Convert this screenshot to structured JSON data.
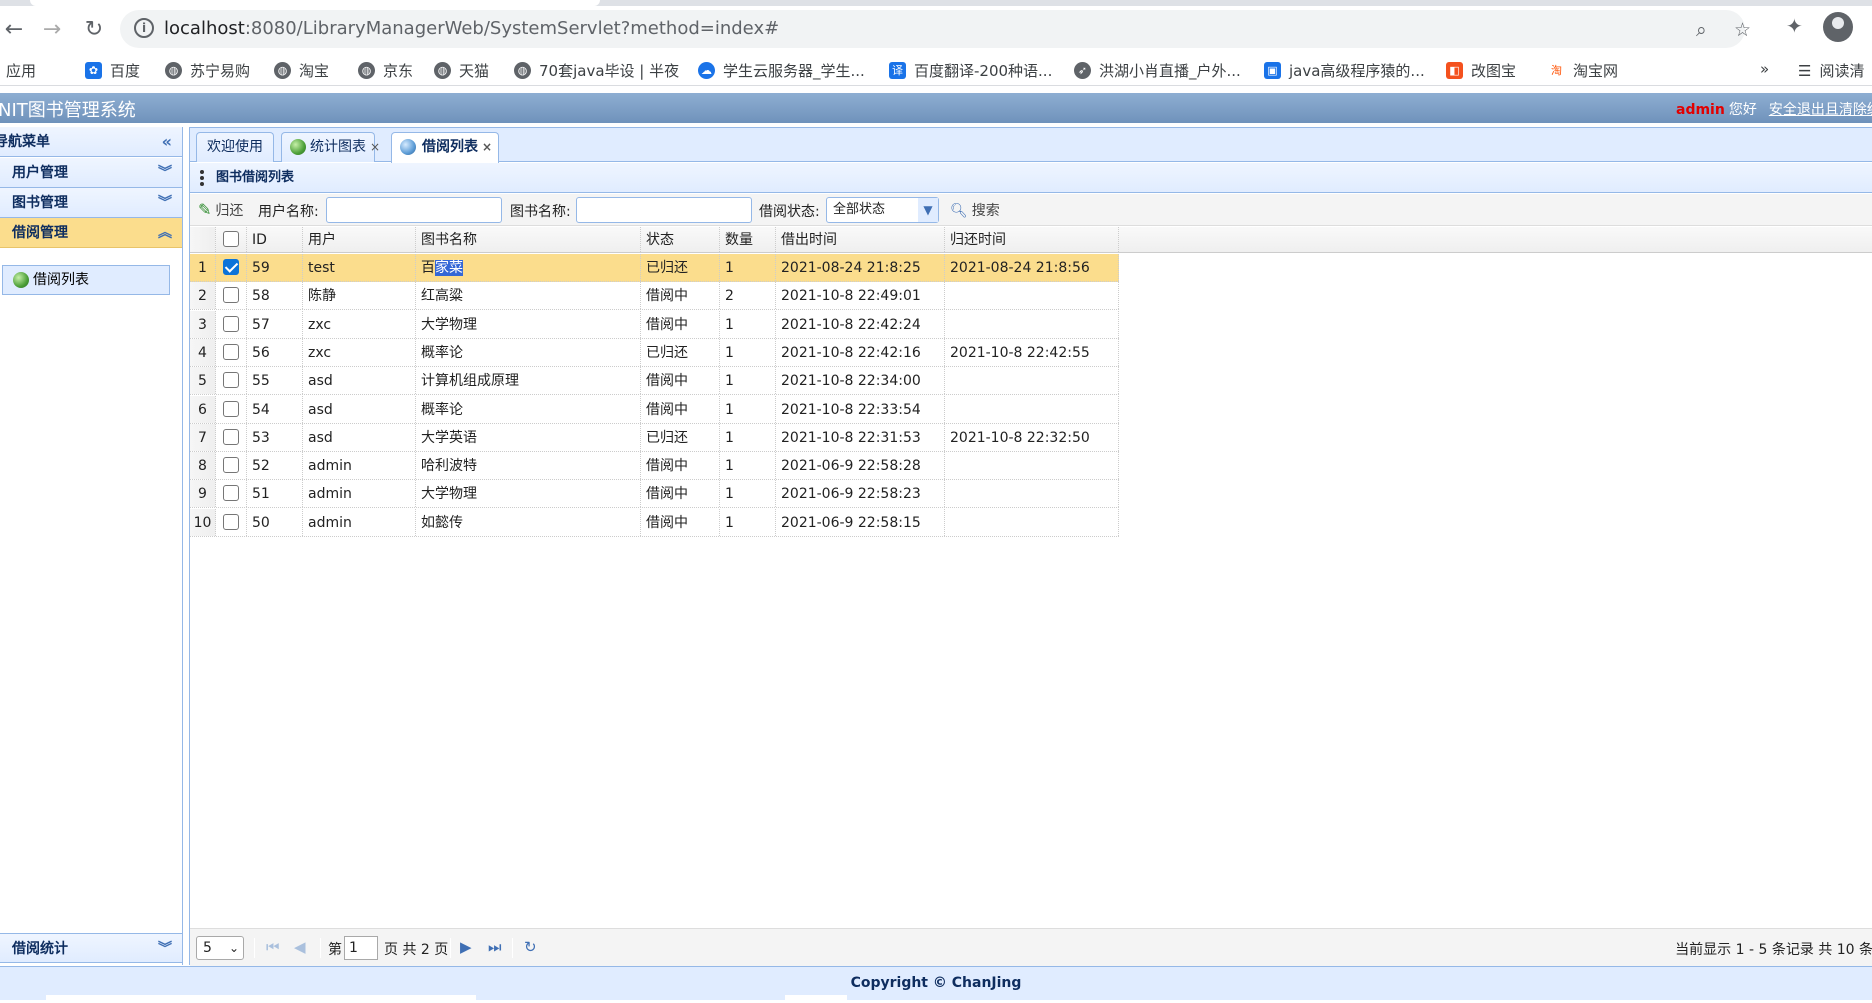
{
  "browser": {
    "url_host": "localhost",
    "url_rest": ":8080/LibraryManagerWeb/SystemServlet?method=index#",
    "bookmarks": [
      "应用",
      "百度",
      "苏宁易购",
      "淘宝",
      "京东",
      "天猫",
      "70套java毕设 | 半夜",
      "学生云服务器_学生...",
      "百度翻译-200种语...",
      "洪湖小肖直播_户外...",
      "java高级程序猿的...",
      "改图宝",
      "淘宝网"
    ],
    "bookmarks_more": "»",
    "reading_list": "阅读清"
  },
  "app": {
    "title": "NIT图书管理系统",
    "user": "admin",
    "greeting": "您好",
    "logout": "安全退出且清除缓"
  },
  "leftnav": {
    "title": "导航菜单",
    "groups": [
      "用户管理",
      "图书管理",
      "借阅管理"
    ],
    "active_item": "借阅列表",
    "bottom_group": "借阅统计"
  },
  "tabs": [
    {
      "label": "欢迎使用"
    },
    {
      "label": "统计图表"
    },
    {
      "label": "借阅列表"
    }
  ],
  "panel": {
    "title": "图书借阅列表"
  },
  "toolbar": {
    "return_label": "归还",
    "user_name_label": "用户名称:",
    "user_name_value": "",
    "book_name_label": "图书名称:",
    "book_name_value": "",
    "status_label": "借阅状态:",
    "status_value": "全部状态",
    "search_label": "搜索"
  },
  "grid": {
    "columns": [
      "ID",
      "用户",
      "图书名称",
      "状态",
      "数量",
      "借出时间",
      "归还时间"
    ],
    "rows": [
      {
        "n": "1",
        "id": "59",
        "user": "test",
        "book": "百家菜",
        "status": "已归还",
        "qty": "1",
        "out": "2021-08-24 21:8:25",
        "ret": "2021-08-24 21:8:56",
        "checked": true
      },
      {
        "n": "2",
        "id": "58",
        "user": "陈静",
        "book": "红高粱",
        "status": "借阅中",
        "qty": "2",
        "out": "2021-10-8 22:49:01",
        "ret": "",
        "checked": false
      },
      {
        "n": "3",
        "id": "57",
        "user": "zxc",
        "book": "大学物理",
        "status": "借阅中",
        "qty": "1",
        "out": "2021-10-8 22:42:24",
        "ret": "",
        "checked": false
      },
      {
        "n": "4",
        "id": "56",
        "user": "zxc",
        "book": "概率论",
        "status": "已归还",
        "qty": "1",
        "out": "2021-10-8 22:42:16",
        "ret": "2021-10-8 22:42:55",
        "checked": false
      },
      {
        "n": "5",
        "id": "55",
        "user": "asd",
        "book": "计算机组成原理",
        "status": "借阅中",
        "qty": "1",
        "out": "2021-10-8 22:34:00",
        "ret": "",
        "checked": false
      },
      {
        "n": "6",
        "id": "54",
        "user": "asd",
        "book": "概率论",
        "status": "借阅中",
        "qty": "1",
        "out": "2021-10-8 22:33:54",
        "ret": "",
        "checked": false
      },
      {
        "n": "7",
        "id": "53",
        "user": "asd",
        "book": "大学英语",
        "status": "已归还",
        "qty": "1",
        "out": "2021-10-8 22:31:53",
        "ret": "2021-10-8 22:32:50",
        "checked": false
      },
      {
        "n": "8",
        "id": "52",
        "user": "admin",
        "book": "哈利波特",
        "status": "借阅中",
        "qty": "1",
        "out": "2021-06-9 22:58:28",
        "ret": "",
        "checked": false
      },
      {
        "n": "9",
        "id": "51",
        "user": "admin",
        "book": "大学物理",
        "status": "借阅中",
        "qty": "1",
        "out": "2021-06-9 22:58:23",
        "ret": "",
        "checked": false
      },
      {
        "n": "10",
        "id": "50",
        "user": "admin",
        "book": "如懿传",
        "status": "借阅中",
        "qty": "1",
        "out": "2021-06-9 22:58:15",
        "ret": "",
        "checked": false
      }
    ]
  },
  "pager": {
    "page_size": "5",
    "page_prefix": "第",
    "page_value": "1",
    "page_suffix": "页 共 2 页",
    "info": "当前显示 1 - 5 条记录 共 10 条"
  },
  "footer": {
    "copyright": "Copyright © ChanJing"
  }
}
